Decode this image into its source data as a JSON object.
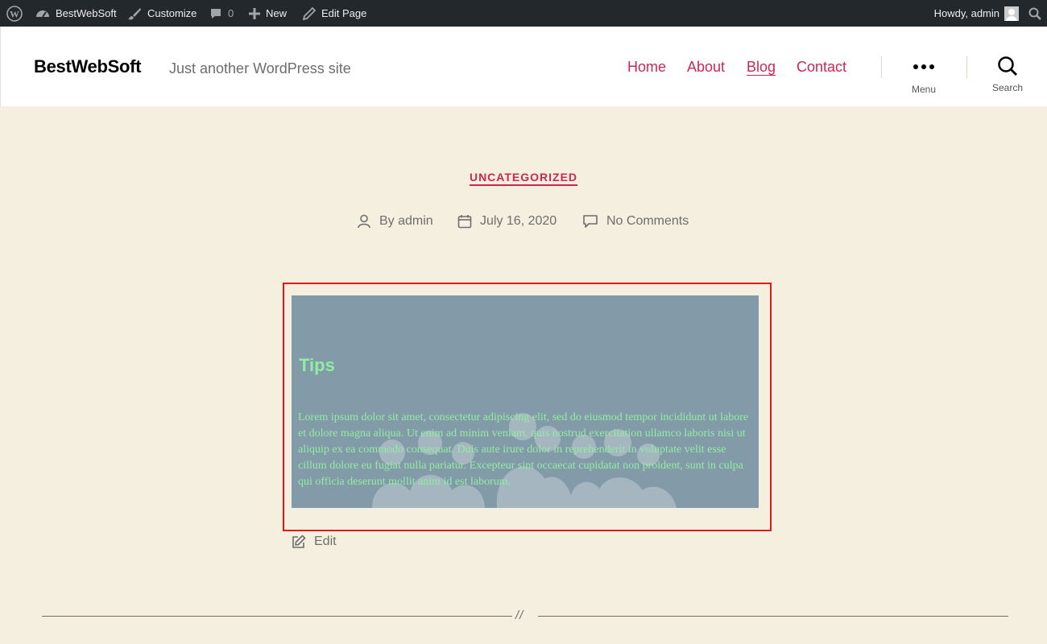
{
  "admin_bar": {
    "site_name": "BestWebSoft",
    "customize": "Customize",
    "comments_count": "0",
    "new": "New",
    "edit_page": "Edit Page",
    "greeting": "Howdy, admin"
  },
  "header": {
    "site_title": "BestWebSoft",
    "tagline": "Just another WordPress site",
    "nav": [
      "Home",
      "About",
      "Blog",
      "Contact"
    ],
    "current_nav": "Blog",
    "menu_label": "Menu",
    "search_label": "Search"
  },
  "post": {
    "category": "UNCATEGORIZED",
    "author": "By admin",
    "date": "July 16, 2020",
    "comments": "No Comments",
    "edit_label": "Edit"
  },
  "cover_block": {
    "title": "Tips",
    "text": "Lorem ipsum dolor sit amet, consectetur adipiscing elit, sed do eiusmod tempor incididunt ut labore et dolore magna aliqua. Ut enim ad minim veniam, quis nostrud exercitation ullamco laboris nisi ut aliquip ex ea commodo consequat. Duis aute irure dolor in reprehenderit in voluptate velit esse cillum dolore eu fugiat nulla pariatur. Excepteur sint occaecat cupidatat non proident, sunt in culpa qui officia deserunt mollit anim id est laborum."
  },
  "separator": "//",
  "colors": {
    "accent": "#cd2653",
    "background": "#f5efe0",
    "admin_bar": "#23282d",
    "cover_overlay": "#839aa9",
    "cover_text": "#90eea0",
    "highlight_border": "#e8141b"
  }
}
